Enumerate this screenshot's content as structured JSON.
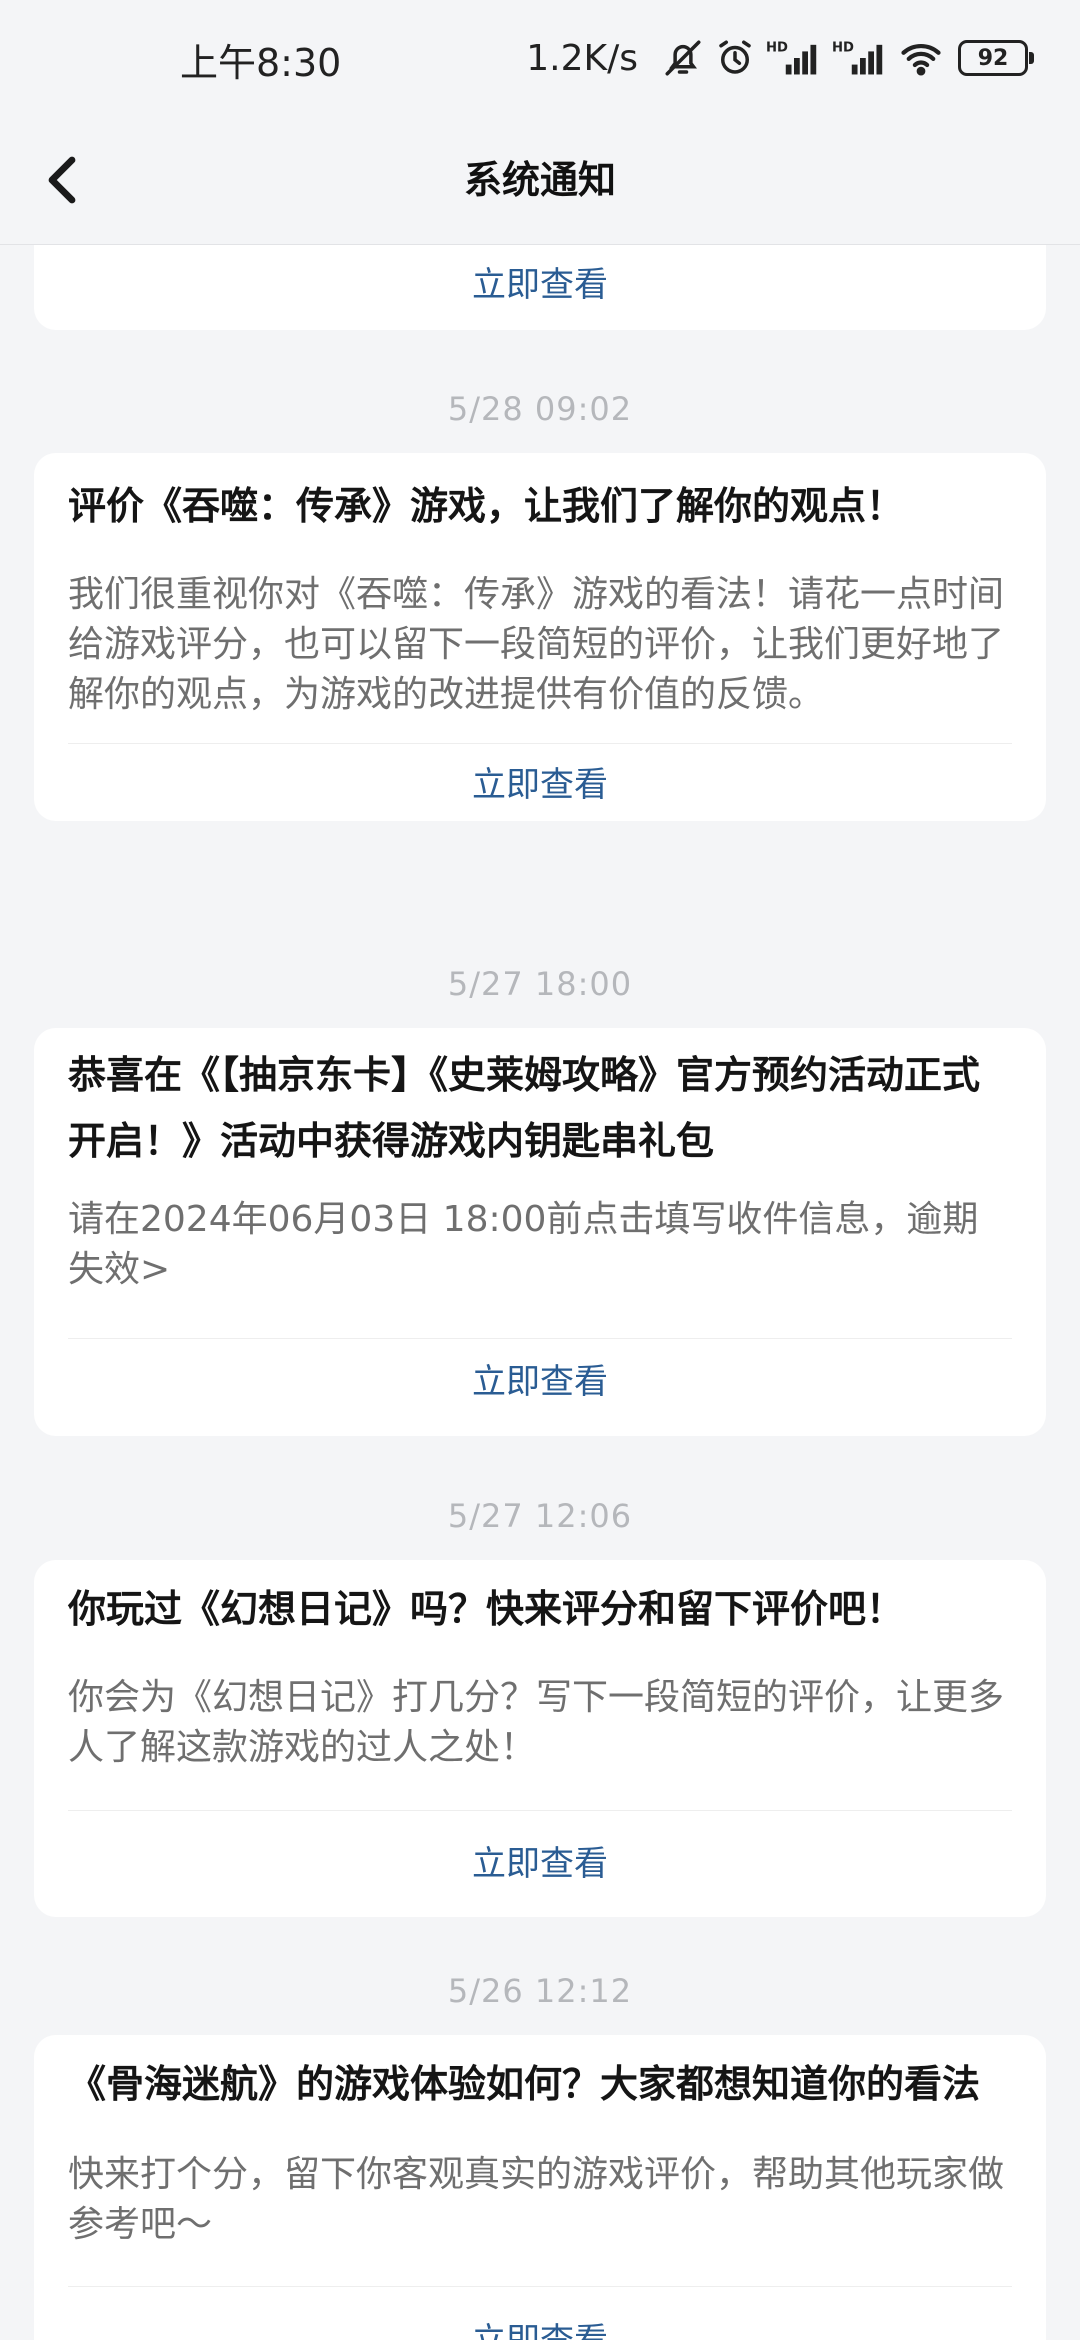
{
  "status_bar": {
    "time": "上午8:30",
    "net_speed": "1.2K/s",
    "battery": "92"
  },
  "header": {
    "title": "系统通知"
  },
  "top_card": {
    "action": "立即查看"
  },
  "notifications": [
    {
      "timestamp": "5/28  09:02",
      "title": "评价《吞噬：传承》游戏，让我们了解你的观点！",
      "body": "我们很重视你对《吞噬：传承》游戏的看法！请花一点时间给游戏评分，也可以留下一段简短的评价，让我们更好地了解你的观点，为游戏的改进提供有价值的反馈。",
      "action": "立即查看"
    },
    {
      "timestamp": "5/27  18:00",
      "title": "恭喜在《【抽京东卡】《史莱姆攻略》官方预约活动正式开启！》活动中获得游戏内钥匙串礼包",
      "body": "请在2024年06月03日 18:00前点击填写收件信息，逾期失效>",
      "action": "立即查看"
    },
    {
      "timestamp": "5/27  12:06",
      "title": "你玩过《幻想日记》吗？快来评分和留下评价吧！",
      "body": "你会为《幻想日记》打几分？写下一段简短的评价，让更多人了解这款游戏的过人之处！",
      "action": "立即查看"
    },
    {
      "timestamp": "5/26  12:12",
      "title": "《骨海迷航》的游戏体验如何？大家都想知道你的看法",
      "body": "快来打个分，留下你客观真实的游戏评价，帮助其他玩家做参考吧～",
      "action": "立即查看"
    }
  ]
}
